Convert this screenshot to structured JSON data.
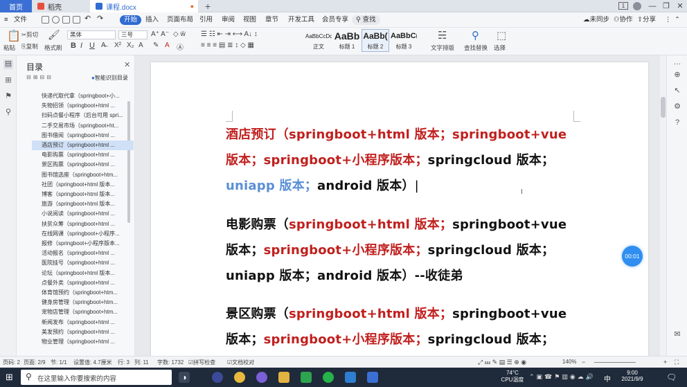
{
  "titlebar": {
    "tabs": [
      {
        "label": "首页"
      },
      {
        "label": "稻壳"
      },
      {
        "label": "课程.docx"
      }
    ],
    "page_badge": "1"
  },
  "menubar": {
    "file": "文件",
    "items": [
      "开始",
      "插入",
      "页面布局",
      "引用",
      "审阅",
      "视图",
      "章节",
      "开发工具",
      "会员专享"
    ],
    "search": "查找",
    "sync": "未同步",
    "collab": "协作",
    "share": "分享"
  },
  "ribbon": {
    "cut": "剪切",
    "copy": "复制",
    "paste": "粘贴",
    "format_painter": "格式刷",
    "font": "黑体",
    "size": "三号",
    "styles": [
      {
        "preview": "AaBbCcDd",
        "label": "正文"
      },
      {
        "preview": "AaBb",
        "label": "标题 1"
      },
      {
        "preview": "AaBb(",
        "label": "标题 2"
      },
      {
        "preview": "AaBbC(",
        "label": "标题 3"
      }
    ],
    "text_layout": "文字排版",
    "find_replace": "查找替换",
    "select": "选择"
  },
  "toc": {
    "title": "目录",
    "smart": "智能识别目录",
    "items": [
      "快递代取代拿（springboot+小...",
      "失物招领（springboot+html ...",
      "扫码点餐小程序（后台可用 spri...",
      "二手交易市场（springboot+ht...",
      "图书借阅（springboot+html ...",
      "酒店预订（springboot+html ...",
      "电影购票（springboot+html ...",
      "景区购票（springboot+html ...",
      "图书馆选座（springboot+htm...",
      "社团（springboot+html 版本...",
      "博客（springboot+html 版本...",
      "旅游（springboot+html 版本...",
      "小说阅读（springboot+html ...",
      "扶贫众筹（springboot+html ...",
      "在线网课（springboot+小程序...",
      "报修（springboot+小程序版本...",
      "活动报名（springboot+html ...",
      "医院挂号（springboot+html ...",
      "论坛（springboot+html 版本...",
      "点餐外卖（springboot+html ...",
      "体育馆预约（springboot+htm...",
      "健身房管理（springboot+htm...",
      "宠物店管理（springboot+htm...",
      "新闻发布（springboot+html ...",
      "美发预约（springboot+html ...",
      "物业管理（springboot+html ..."
    ],
    "selected_index": 5
  },
  "document": {
    "p1": {
      "a": "酒店预订（springboot+html 版本；springboot+vue 版本；",
      "b": "springboot+小程序版本；",
      "c": "springcloud 版本；",
      "d": "uniapp 版本；",
      "e": "android 版本）"
    },
    "p2": {
      "a": "电影购票（",
      "b": "springboot+html 版本；",
      "c": "springboot+vue 版本；",
      "d": "springboot+小程序版本；",
      "e": "springcloud 版本；uniapp 版本；",
      "f": "android 版本）--收徒弟"
    },
    "p3": {
      "a": "景区购票（",
      "b": "springboot+html 版本；",
      "c": "springboot+vue 版本；",
      "d": "springboot+小程序版本；",
      "e": "springcloud 版本；uniapp 版本；"
    },
    "timer": "00:01"
  },
  "statusbar": {
    "page": "页码: 2",
    "pages": "页面: 2/9",
    "section": "节: 1/1",
    "position": "设置值: 4.7厘米",
    "row": "行: 3",
    "col": "列: 11",
    "words": "字数: 1732",
    "spell": "拼写检查",
    "proof": "文档校对",
    "zoom": "140%"
  },
  "taskbar": {
    "search_placeholder": "在这里输入你要搜索的内容",
    "temp": "74°C",
    "cpu": "CPU温度",
    "ime": "中",
    "time": "9:00",
    "date": "2021/9/9"
  }
}
